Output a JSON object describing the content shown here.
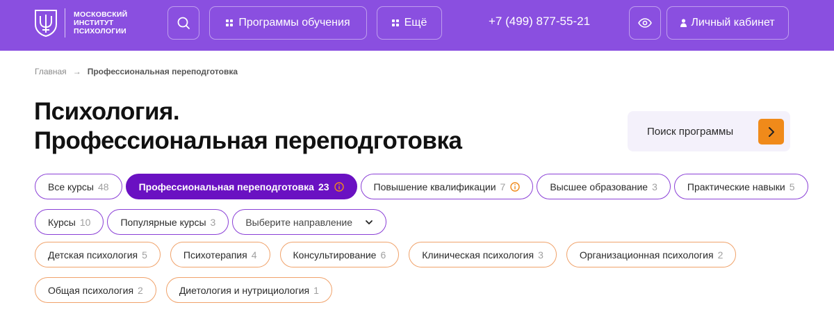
{
  "header": {
    "logo_lines": [
      "МОСКОВСКИЙ",
      "ИНСТИТУТ",
      "ПСИХОЛОГИИ"
    ],
    "programs_label": "Программы обучения",
    "more_label": "Ещё",
    "phone": "+7 (499) 877-55-21",
    "cabinet_label": "Личный кабинет",
    "icons": {
      "search": "search-icon",
      "programs": "grid-icon",
      "more": "grid-icon",
      "eye": "eye-icon",
      "cabinet": "user-icon"
    },
    "colors": {
      "background": "#8a4fe0"
    }
  },
  "breadcrumb": {
    "home": "Главная",
    "current": "Профессиональная переподготовка"
  },
  "title": {
    "line1": "Психология.",
    "line2": "Профессиональная переподготовка"
  },
  "program_search": {
    "label": "Поиск программы",
    "button_icon": "chevron-right-icon",
    "colors": {
      "button": "#f08a1a",
      "background": "#f4f1fb"
    }
  },
  "level_filters": [
    {
      "label": "Все курсы",
      "count": "48"
    },
    {
      "label": "Профессиональная переподготовка",
      "count": "23",
      "active": true,
      "info": true
    },
    {
      "label": "Повышение квалификации",
      "count": "7",
      "info": true
    },
    {
      "label": "Высшее образование",
      "count": "3"
    },
    {
      "label": "Практические навыки",
      "count": "5"
    }
  ],
  "type_filters": [
    {
      "label": "Курсы",
      "count": "10"
    },
    {
      "label": "Популярные курсы",
      "count": "3"
    }
  ],
  "direction_select": {
    "placeholder": "Выберите направление",
    "icon": "chevron-down-icon"
  },
  "topic_filters": [
    {
      "label": "Детская психология",
      "count": "5"
    },
    {
      "label": "Психотерапия",
      "count": "4"
    },
    {
      "label": "Консультирование",
      "count": "6"
    },
    {
      "label": "Клиническая психология",
      "count": "3"
    },
    {
      "label": "Организационная психология",
      "count": "2"
    },
    {
      "label": "Общая психология",
      "count": "2"
    },
    {
      "label": "Диетология и нутрициология",
      "count": "1"
    }
  ],
  "colors": {
    "accent_purple": "#6a11c2",
    "chip_border_purple": "#8a3fd6",
    "chip_border_orange": "#f0a26a",
    "info_orange": "#f08a1a"
  }
}
